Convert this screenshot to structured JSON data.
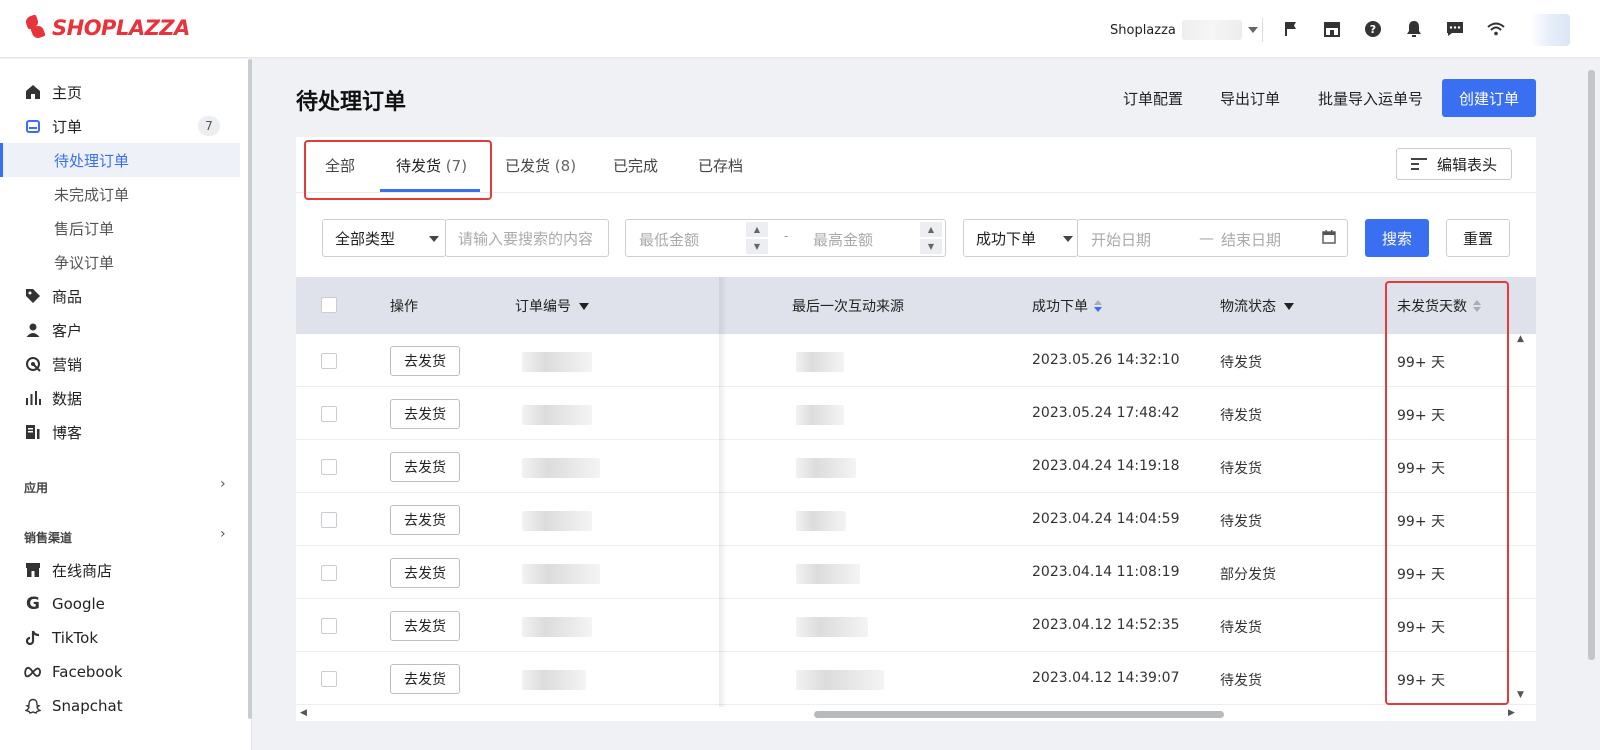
{
  "brand": {
    "name": "SHOPLAZZA"
  },
  "topbar": {
    "store_name": "Shoplazza",
    "icons": [
      "flag-icon",
      "store-icon",
      "help-icon",
      "bell-icon",
      "chat-icon",
      "wifi-icon"
    ]
  },
  "sidebar": {
    "items": [
      {
        "label": "主页",
        "icon": "home-icon"
      },
      {
        "label": "订单",
        "icon": "orders-icon",
        "badge": "7"
      },
      {
        "label": "待处理订单",
        "active": true
      },
      {
        "label": "未完成订单"
      },
      {
        "label": "售后订单"
      },
      {
        "label": "争议订单"
      },
      {
        "label": "商品",
        "icon": "tag-icon"
      },
      {
        "label": "客户",
        "icon": "user-icon"
      },
      {
        "label": "营销",
        "icon": "marketing-icon"
      },
      {
        "label": "数据",
        "icon": "chart-icon"
      },
      {
        "label": "博客",
        "icon": "blog-icon"
      }
    ],
    "apps_title": "应用",
    "channels_title": "销售渠道",
    "channels": [
      {
        "label": "在线商店",
        "icon": "store-icon"
      },
      {
        "label": "Google",
        "icon": "google-icon"
      },
      {
        "label": "TikTok",
        "icon": "tiktok-icon"
      },
      {
        "label": "Facebook",
        "icon": "meta-icon"
      },
      {
        "label": "Snapchat",
        "icon": "snapchat-icon"
      }
    ]
  },
  "header": {
    "title": "待处理订单",
    "actions": [
      "订单配置",
      "导出订单",
      "批量导入运单号"
    ],
    "create_label": "创建订单"
  },
  "tabs": [
    {
      "label": "全部"
    },
    {
      "label": "待发货",
      "count": "(7)",
      "active": true
    },
    {
      "label": "已发货",
      "count": "(8)"
    },
    {
      "label": "已完成"
    },
    {
      "label": "已存档"
    }
  ],
  "edit_header_label": "编辑表头",
  "filters": {
    "type_select": "全部类型",
    "search_placeholder": "请输入要搜索的内容",
    "min_amount_placeholder": "最低金额",
    "max_amount_placeholder": "最高金额",
    "amount_separator": "-",
    "date_type_select": "成功下单",
    "start_date_placeholder": "开始日期",
    "date_separator": "—",
    "end_date_placeholder": "结束日期",
    "search_label": "搜索",
    "reset_label": "重置"
  },
  "table": {
    "columns": [
      "操作",
      "订单编号",
      "最后一次互动来源",
      "成功下单",
      "物流状态",
      "未发货天数"
    ],
    "ship_label": "去发货",
    "rows": [
      {
        "date": "2023.05.26 14:32:10",
        "status": "待发货",
        "days": "99+ 天"
      },
      {
        "date": "2023.05.24 17:48:42",
        "status": "待发货",
        "days": "99+ 天"
      },
      {
        "date": "2023.04.24 14:19:18",
        "status": "待发货",
        "days": "99+ 天"
      },
      {
        "date": "2023.04.24 14:04:59",
        "status": "待发货",
        "days": "99+ 天"
      },
      {
        "date": "2023.04.14 11:08:19",
        "status": "部分发货",
        "days": "99+ 天"
      },
      {
        "date": "2023.04.12 14:52:35",
        "status": "待发货",
        "days": "99+ 天"
      },
      {
        "date": "2023.04.12 14:39:07",
        "status": "待发货",
        "days": "99+ 天"
      }
    ]
  },
  "colors": {
    "accent": "#3a6ff2",
    "highlight": "#e53a3a",
    "brand": "#e8323c"
  }
}
